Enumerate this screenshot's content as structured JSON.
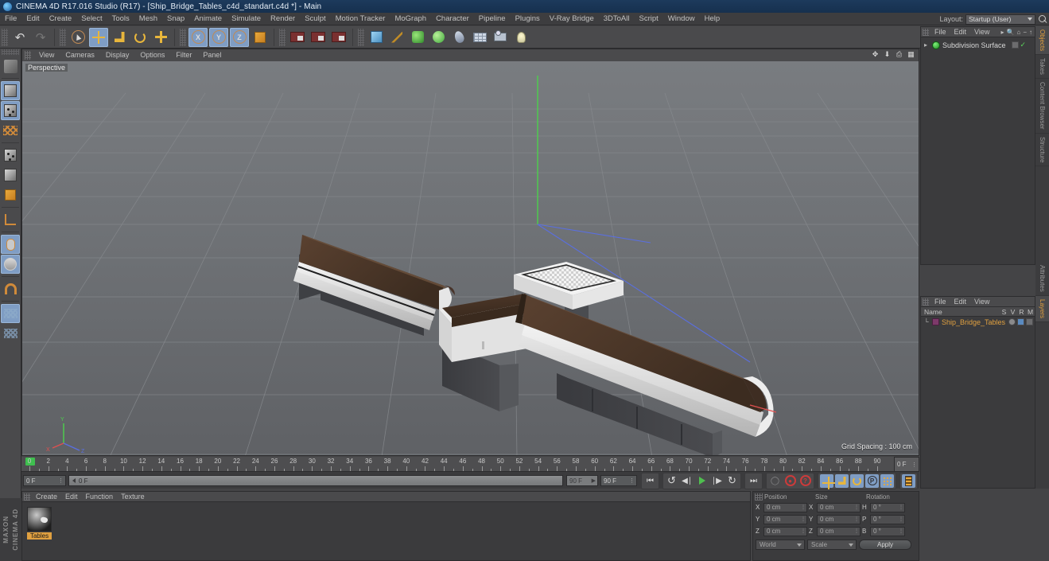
{
  "titlebar": {
    "text": "CINEMA 4D R17.016 Studio (R17) - [Ship_Bridge_Tables_c4d_standart.c4d *] - Main",
    "icon": "c4d-logo-icon"
  },
  "menubar": {
    "items": [
      "File",
      "Edit",
      "Create",
      "Select",
      "Tools",
      "Mesh",
      "Snap",
      "Animate",
      "Simulate",
      "Render",
      "Sculpt",
      "Motion Tracker",
      "MoGraph",
      "Character",
      "Pipeline",
      "Plugins",
      "V-Ray Bridge",
      "3DToAll",
      "Script",
      "Window",
      "Help"
    ]
  },
  "layout": {
    "label": "Layout:",
    "value": "Startup (User)"
  },
  "toolbar": {
    "groups": [
      {
        "name": "history",
        "buttons": [
          {
            "name": "undo-button",
            "glyph": "↶",
            "active": false
          },
          {
            "name": "redo-button",
            "glyph": "↷",
            "active": false
          }
        ]
      },
      {
        "name": "transform",
        "buttons": [
          {
            "name": "select-tool-button",
            "glyph": "",
            "active": true
          },
          {
            "name": "move-tool-button",
            "glyph": "",
            "active": true
          },
          {
            "name": "scale-tool-button",
            "glyph": "",
            "active": false
          },
          {
            "name": "rotate-tool-button",
            "glyph": "",
            "active": false
          },
          {
            "name": "add-tool-button",
            "glyph": "",
            "active": false
          }
        ]
      },
      {
        "name": "axis-locks",
        "buttons": [
          {
            "name": "x-axis-lock-button",
            "glyph": "X",
            "active": true
          },
          {
            "name": "y-axis-lock-button",
            "glyph": "Y",
            "active": true
          },
          {
            "name": "z-axis-lock-button",
            "glyph": "Z",
            "active": true
          },
          {
            "name": "world-object-axis-button",
            "glyph": "",
            "active": false
          }
        ]
      },
      {
        "name": "render",
        "buttons": [
          {
            "name": "render-view-button",
            "glyph": "",
            "active": false
          },
          {
            "name": "render-region-button",
            "glyph": "",
            "active": false
          },
          {
            "name": "render-settings-button",
            "glyph": "",
            "active": false
          }
        ]
      },
      {
        "name": "objects",
        "buttons": [
          {
            "name": "add-cube-button",
            "glyph": "",
            "active": false
          },
          {
            "name": "spline-pen-button",
            "glyph": "",
            "active": false
          },
          {
            "name": "nurbs-button",
            "glyph": "",
            "active": false
          },
          {
            "name": "array-button",
            "glyph": "",
            "active": false
          },
          {
            "name": "deformer-button",
            "glyph": "",
            "active": false
          },
          {
            "name": "floor-environment-button",
            "glyph": "",
            "active": false
          },
          {
            "name": "camera-button",
            "glyph": "",
            "active": false
          },
          {
            "name": "light-button",
            "glyph": "",
            "active": false
          }
        ]
      }
    ]
  },
  "left_toolbar": {
    "buttons": [
      {
        "name": "live-selection-tool",
        "active": false
      },
      {
        "name": "model-mode-button",
        "active": true
      },
      {
        "name": "object-mode-button",
        "active": true
      },
      {
        "name": "texture-mode-button",
        "active": false
      },
      {
        "name": "points-mode-button",
        "active": false
      },
      {
        "name": "edges-mode-button",
        "active": false
      },
      {
        "name": "polygons-mode-button",
        "active": false
      },
      {
        "name": "axis-modify-button",
        "active": false
      },
      {
        "name": "viewport-solo-button",
        "active": true
      },
      {
        "name": "enable-snap-button",
        "active": true
      },
      {
        "name": "workplane-button",
        "active": false
      },
      {
        "name": "quantize-lock-button",
        "active": true
      },
      {
        "name": "workplane-lock-button",
        "active": false
      }
    ]
  },
  "viewport": {
    "menu": [
      "View",
      "Cameras",
      "Display",
      "Options",
      "Filter",
      "Panel"
    ],
    "camera_label": "Perspective",
    "grid_spacing": "Grid Spacing : 100 cm",
    "nav_icons": [
      "pan-icon",
      "dolly-icon",
      "orbit-icon",
      "maximize-viewport-icon"
    ],
    "scene_description": "Three white and dark-brown ship bridge tables on a grey ground grid"
  },
  "object_manager": {
    "menu": [
      "File",
      "Edit",
      "View"
    ],
    "header_icons": [
      "search-icon",
      "home-icon",
      "minus-icon",
      "up-icon"
    ],
    "items": [
      {
        "name": "Subdivision Surface",
        "selected": false,
        "tags": [
          "editor-visibility-tag",
          "render-visibility-tag"
        ]
      }
    ]
  },
  "material_manager_right": {
    "menu": [
      "File",
      "Edit",
      "View"
    ],
    "columns": [
      "Name",
      "S",
      "V",
      "R",
      "M"
    ],
    "rows": [
      {
        "name": "Ship_Bridge_Tables",
        "selected": true
      }
    ]
  },
  "vertical_tabs": {
    "top": [
      {
        "label": "Objects",
        "active": true
      },
      {
        "label": "Takes",
        "active": false
      },
      {
        "label": "Content Browser",
        "active": false
      },
      {
        "label": "Structure",
        "active": false
      }
    ],
    "bottom": [
      {
        "label": "Attributes",
        "active": false
      },
      {
        "label": "Layers",
        "active": true
      }
    ]
  },
  "timeline": {
    "start_frame": "0 F",
    "end_frame": "90 F",
    "current_frame": "0 F",
    "preview_min": "0 F",
    "preview_max": "90 F",
    "ticks": [
      0,
      2,
      4,
      6,
      8,
      10,
      12,
      14,
      16,
      18,
      20,
      22,
      24,
      26,
      28,
      30,
      32,
      34,
      36,
      38,
      40,
      42,
      44,
      46,
      48,
      50,
      52,
      54,
      56,
      58,
      60,
      62,
      64,
      66,
      68,
      70,
      72,
      74,
      76,
      78,
      80,
      82,
      84,
      86,
      88,
      90
    ],
    "transport": [
      {
        "name": "go-to-start-button",
        "glyph": "⏮"
      },
      {
        "name": "play-backwards-button",
        "glyph": "↺"
      },
      {
        "name": "step-back-button",
        "glyph": "◀│"
      },
      {
        "name": "play-forward-button",
        "glyph": "▶"
      },
      {
        "name": "step-forward-button",
        "glyph": "│▶"
      },
      {
        "name": "play-loop-button",
        "glyph": "↻"
      },
      {
        "name": "go-to-end-button",
        "glyph": "⏭"
      }
    ],
    "record_buttons": [
      {
        "name": "autokeying-button",
        "glyph": "○"
      },
      {
        "name": "record-active-objects-button",
        "glyph": "◉"
      },
      {
        "name": "keyframe-selection-button",
        "glyph": "?"
      }
    ],
    "key_toggles": [
      {
        "name": "position-key-button",
        "active": true
      },
      {
        "name": "scale-key-button",
        "active": true
      },
      {
        "name": "rotation-key-button",
        "active": true
      },
      {
        "name": "parameter-key-button",
        "active": true
      },
      {
        "name": "point-level-animation-button",
        "active": true
      },
      {
        "name": "keyframe-mode-button",
        "active": true
      }
    ]
  },
  "material_manager": {
    "menu": [
      "Create",
      "Edit",
      "Function",
      "Texture"
    ],
    "materials": [
      {
        "name": "Tables",
        "selected": true
      }
    ]
  },
  "coordinates": {
    "headers": [
      "Position",
      "Size",
      "Rotation"
    ],
    "rows": [
      {
        "axis1": "X",
        "val1": "0 cm",
        "axis2": "X",
        "val2": "0 cm",
        "axis3": "H",
        "val3": "0 °"
      },
      {
        "axis1": "Y",
        "val1": "0 cm",
        "axis2": "Y",
        "val2": "0 cm",
        "axis3": "P",
        "val3": "0 °"
      },
      {
        "axis1": "Z",
        "val1": "0 cm",
        "axis2": "Z",
        "val2": "0 cm",
        "axis3": "B",
        "val3": "0 °"
      }
    ],
    "coord_system": "World",
    "size_mode": "Scale",
    "apply_label": "Apply"
  },
  "brand": {
    "line1": "MAXON",
    "line2": "CINEMA 4D"
  },
  "colors": {
    "titlebar": "#1d3a5c",
    "chrome": "#4a4a4c",
    "panel": "#3b3b3d",
    "viewport_bg": "#6e7074",
    "accent_orange": "#e0a040",
    "accent_blue": "#7f9dc4",
    "table_top": "#4a3528",
    "table_rim": "#e8e8e8",
    "table_base": "#4a4a4c"
  }
}
